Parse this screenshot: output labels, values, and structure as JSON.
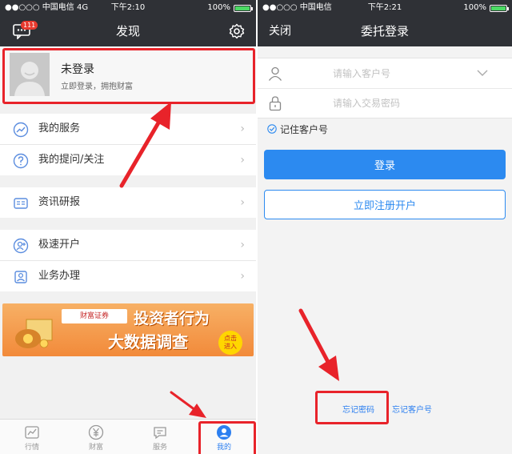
{
  "left": {
    "status": {
      "carrier": "●●○○○ 中国电信  4G",
      "time": "下午2:10",
      "battery": "100%",
      "battery_level": 1.0
    },
    "nav": {
      "title": "发现",
      "badge": "111"
    },
    "profile": {
      "name": "未登录",
      "subtitle": "立即登录，拥抱财富"
    },
    "menu_group1": [
      {
        "label": "我的服务",
        "icon": "chart-trend-icon"
      },
      {
        "label": "我的提问/关注",
        "icon": "question-icon"
      }
    ],
    "menu_group2": [
      {
        "label": "资讯研报",
        "icon": "news-icon"
      }
    ],
    "menu_group3": [
      {
        "label": "极速开户",
        "icon": "user-add-icon"
      },
      {
        "label": "业务办理",
        "icon": "person-card-icon"
      }
    ],
    "chevron": "›",
    "banner": {
      "logo": "财富证券",
      "line1": "投资者行为",
      "line2": "大数据调查",
      "cta_1": "点击",
      "cta_2": "进入"
    },
    "tabs": [
      {
        "label": "行情",
        "icon": "trend-tab-icon",
        "active": false
      },
      {
        "label": "财富",
        "icon": "yen-tab-icon",
        "active": false
      },
      {
        "label": "服务",
        "icon": "service-tab-icon",
        "active": false
      },
      {
        "label": "我的",
        "icon": "profile-tab-icon",
        "active": true
      }
    ]
  },
  "right": {
    "status": {
      "carrier": "●●○○○ 中国电信",
      "time": "下午2:21",
      "battery": "100%",
      "battery_level": 1.0
    },
    "nav": {
      "close": "关闭",
      "title": "委托登录"
    },
    "form": {
      "account_placeholder": "请输入客户号",
      "password_placeholder": "请输入交易密码"
    },
    "remember": "记住客户号",
    "login_button": "登录",
    "register_button": "立即注册开户",
    "forgot_password": "忘记密码",
    "forgot_account": "忘记客户号"
  },
  "colors": {
    "accent": "#2c8af0",
    "highlight": "#e8232a",
    "header": "#2f3136"
  }
}
